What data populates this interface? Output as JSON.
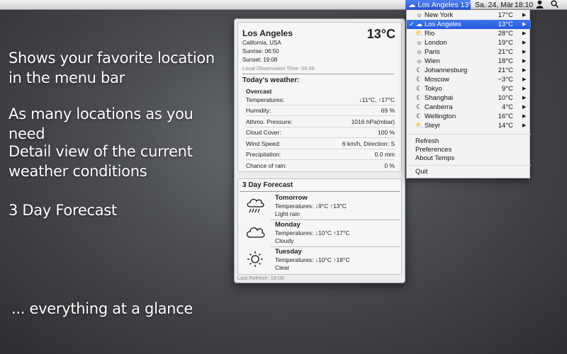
{
  "menubar": {
    "weather": "Los Angeles 13°C",
    "date": "Sa. 24. Mär",
    "time": "18:10"
  },
  "promo": {
    "line1": "Shows your favorite location in the menu bar",
    "line2": "As many locations as you need",
    "line3": "Detail view of the current weather conditions",
    "line4": "3 Day Forecast",
    "line5": "... everything at a glance"
  },
  "panel": {
    "city": "Los Angeles",
    "region": "California, USA",
    "sunrise": "Sunrise: 06:50",
    "sunset": "Sunset: 19:08",
    "observation": "Local Observation Time: 09:39",
    "temperature": "13°C",
    "today_title": "Today's weather:",
    "condition": "Overcast",
    "rows": [
      {
        "k": "Temperatures:",
        "v": "↓11°C, ↑17°C"
      },
      {
        "k": "Humidity:",
        "v": "69 %"
      },
      {
        "k": "Athmo. Pressure:",
        "v": "1016 hPa(mbar)"
      },
      {
        "k": "Cloud Cover:",
        "v": "100 %"
      },
      {
        "k": "Wind Speed:",
        "v": "6 km/h, Direction: S"
      },
      {
        "k": "Precipitation:",
        "v": "0.0 mm"
      },
      {
        "k": "Chance of rain:",
        "v": "0 %"
      }
    ],
    "forecast_title": "3 Day Forecast",
    "forecast": [
      {
        "day": "Tomorrow",
        "temps": "Temperatures: ↓9°C  ↑13°C",
        "desc": "Light rain",
        "icon": "rain-cloud-icon"
      },
      {
        "day": "Monday",
        "temps": "Temperatures: ↓10°C  ↑17°C",
        "desc": "Cloudy",
        "icon": "cloud-icon"
      },
      {
        "day": "Tuesday",
        "temps": "Temperatures: ↓10°C  ↑18°C",
        "desc": "Clear",
        "icon": "sun-icon"
      }
    ],
    "last_refresh": "Last Refresh: 18:09"
  },
  "dropdown": {
    "locations": [
      {
        "name": "New York",
        "temp": "17°C",
        "icon": "sun-icon",
        "selected": false
      },
      {
        "name": "Los Angeles",
        "temp": "13°C",
        "icon": "cloud-icon",
        "selected": true
      },
      {
        "name": "Rio",
        "temp": "28°C",
        "icon": "partly-cloudy-icon",
        "selected": false
      },
      {
        "name": "London",
        "temp": "19°C",
        "icon": "sun-icon",
        "selected": false
      },
      {
        "name": "Paris",
        "temp": "21°C",
        "icon": "sun-icon",
        "selected": false
      },
      {
        "name": "Wien",
        "temp": "18°C",
        "icon": "sun-icon",
        "selected": false
      },
      {
        "name": "Johannesburg",
        "temp": "21°C",
        "icon": "moon-icon",
        "selected": false
      },
      {
        "name": "Moscow",
        "temp": "−3°C",
        "icon": "moon-icon",
        "selected": false
      },
      {
        "name": "Tokyo",
        "temp": "9°C",
        "icon": "moon-icon",
        "selected": false
      },
      {
        "name": "Shanghai",
        "temp": "10°C",
        "icon": "moon-icon",
        "selected": false
      },
      {
        "name": "Canberra",
        "temp": "4°C",
        "icon": "moon-icon",
        "selected": false
      },
      {
        "name": "Wellington",
        "temp": "16°C",
        "icon": "moon-icon",
        "selected": false
      },
      {
        "name": "Steyr",
        "temp": "14°C",
        "icon": "partly-cloudy-icon",
        "selected": false
      }
    ],
    "actions": {
      "refresh": "Refresh",
      "preferences": "Preferences",
      "about": "About Temps",
      "quit": "Quit"
    }
  }
}
